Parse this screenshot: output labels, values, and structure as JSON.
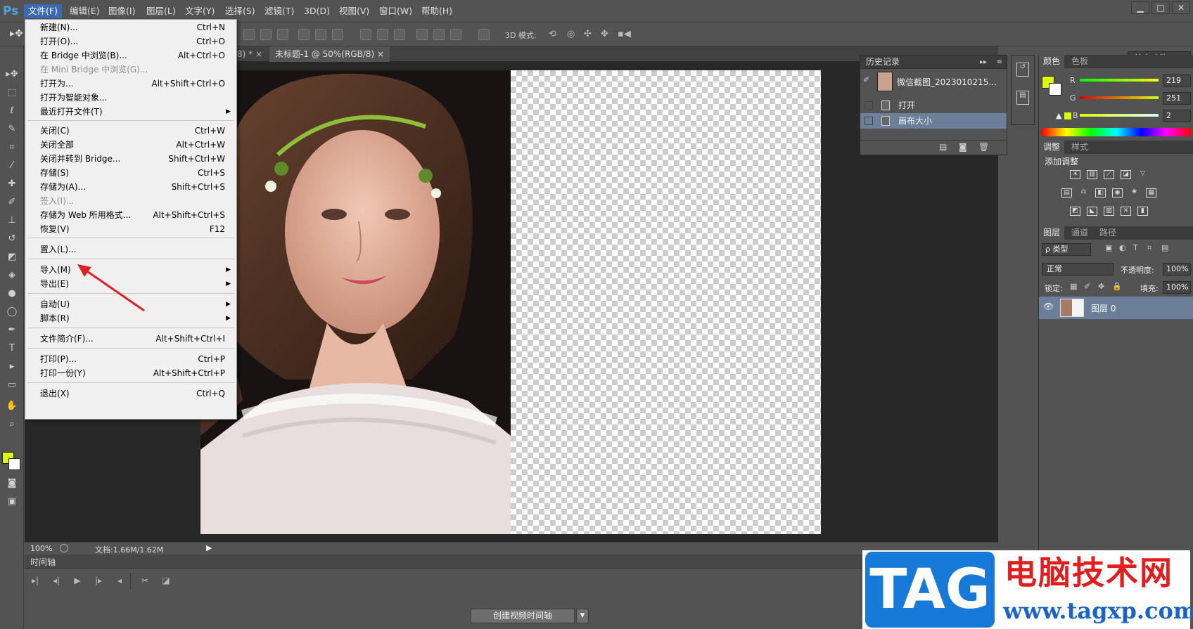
{
  "app": {
    "logo": "Ps"
  },
  "menubar": {
    "items": [
      "文件(F)",
      "编辑(E)",
      "图像(I)",
      "图层(L)",
      "文字(Y)",
      "选择(S)",
      "滤镜(T)",
      "3D(D)",
      "视图(V)",
      "窗口(W)",
      "帮助(H)"
    ],
    "window_buttons": [
      "▁",
      "□",
      "✕"
    ]
  },
  "options": {
    "mode_label": "3D 模式:",
    "workspace": "基本功能"
  },
  "tabs": [
    {
      "label": "/8) *"
    },
    {
      "label": "未标题-1 @ 50%(RGB/8)"
    }
  ],
  "tab_close": "×",
  "statusbar": {
    "zoom": "100%",
    "doc": "文档:1.66M/1.62M"
  },
  "timeline": {
    "title": "时间轴",
    "create": "创建视频时间轴"
  },
  "history": {
    "title": "历史记录",
    "snapshot": "微信截图_2023010215...",
    "items": [
      "打开",
      "画布大小"
    ]
  },
  "color_panel": {
    "tabs": [
      "颜色",
      "色板"
    ],
    "r_label": "R",
    "g_label": "G",
    "b_label": "B",
    "r": "219",
    "g": "251",
    "b": "2",
    "fg": "#dbfb02"
  },
  "adjust_panel": {
    "tabs": [
      "调整",
      "样式"
    ],
    "title": "添加调整"
  },
  "layers_panel": {
    "tabs": [
      "图层",
      "通道",
      "路径"
    ],
    "filter": "ρ 类型",
    "blend": "正常",
    "opacity_label": "不透明度:",
    "opacity": "100%",
    "lock_label": "锁定:",
    "fill_label": "填充:",
    "fill": "100%",
    "layer_name": "图层 0"
  },
  "file_menu": [
    {
      "label": "新建(N)...",
      "shortcut": "Ctrl+N"
    },
    {
      "label": "打开(O)...",
      "shortcut": "Ctrl+O"
    },
    {
      "label": "在 Bridge 中浏览(B)...",
      "shortcut": "Alt+Ctrl+O"
    },
    {
      "label": "在 Mini Bridge 中浏览(G)...",
      "shortcut": "",
      "disabled": true
    },
    {
      "label": "打开为...",
      "shortcut": "Alt+Shift+Ctrl+O"
    },
    {
      "label": "打开为智能对象...",
      "shortcut": ""
    },
    {
      "label": "最近打开文件(T)",
      "shortcut": "",
      "submenu": true
    },
    {
      "label": "关闭(C)",
      "shortcut": "Ctrl+W"
    },
    {
      "label": "关闭全部",
      "shortcut": "Alt+Ctrl+W"
    },
    {
      "label": "关闭并转到 Bridge...",
      "shortcut": "Shift+Ctrl+W"
    },
    {
      "label": "存储(S)",
      "shortcut": "Ctrl+S"
    },
    {
      "label": "存储为(A)...",
      "shortcut": "Shift+Ctrl+S"
    },
    {
      "label": "签入(I)...",
      "shortcut": "",
      "disabled": true
    },
    {
      "label": "存储为 Web 所用格式...",
      "shortcut": "Alt+Shift+Ctrl+S"
    },
    {
      "label": "恢复(V)",
      "shortcut": "F12"
    },
    {
      "label": "置入(L)...",
      "shortcut": ""
    },
    {
      "label": "导入(M)",
      "shortcut": "",
      "submenu": true
    },
    {
      "label": "导出(E)",
      "shortcut": "",
      "submenu": true
    },
    {
      "label": "自动(U)",
      "shortcut": "",
      "submenu": true
    },
    {
      "label": "脚本(R)",
      "shortcut": "",
      "submenu": true
    },
    {
      "label": "文件简介(F)...",
      "shortcut": "Alt+Shift+Ctrl+I"
    },
    {
      "label": "打印(P)...",
      "shortcut": "Ctrl+P"
    },
    {
      "label": "打印一份(Y)",
      "shortcut": "Alt+Shift+Ctrl+P"
    },
    {
      "label": "退出(X)",
      "shortcut": "Ctrl+Q"
    }
  ],
  "watermark": {
    "logo": "TAG",
    "title": "电脑技术网",
    "url": "www.tagxp.com"
  },
  "colors": {
    "accent": "#3b6ab3",
    "menu_bg": "#f0f0f0",
    "arrow": "#e02020"
  }
}
